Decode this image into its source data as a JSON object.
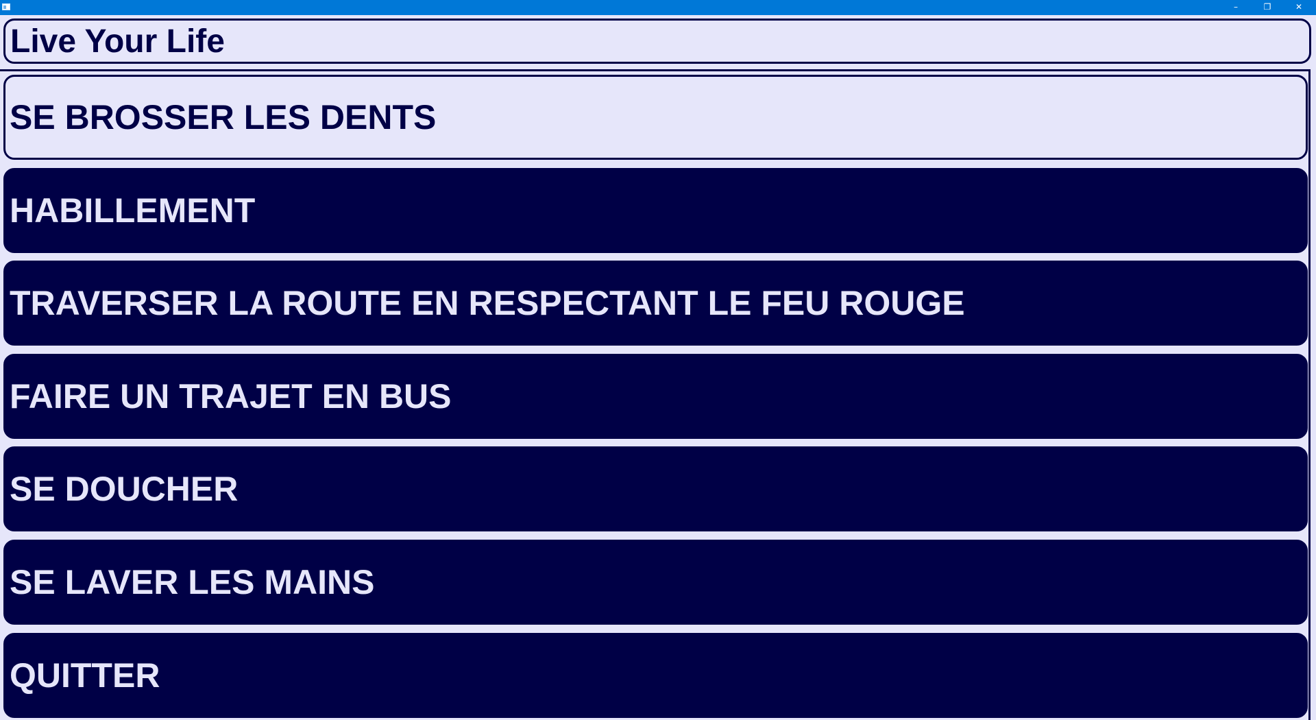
{
  "window": {
    "minimize_glyph": "–",
    "restore_glyph": "❐",
    "close_glyph": "✕"
  },
  "header": {
    "title": "Live Your Life"
  },
  "menu": {
    "items": [
      {
        "label": "SE BROSSER LES DENTS",
        "selected": true
      },
      {
        "label": "HABILLEMENT",
        "selected": false
      },
      {
        "label": "TRAVERSER LA ROUTE EN RESPECTANT LE FEU ROUGE",
        "selected": false
      },
      {
        "label": "FAIRE UN TRAJET EN BUS",
        "selected": false
      },
      {
        "label": "SE DOUCHER",
        "selected": false
      },
      {
        "label": "SE LAVER LES MAINS",
        "selected": false
      },
      {
        "label": "QUITTER",
        "selected": false
      }
    ]
  },
  "colors": {
    "titlebar": "#0078d7",
    "navy": "#000046",
    "lavender": "#e6e6fa"
  }
}
